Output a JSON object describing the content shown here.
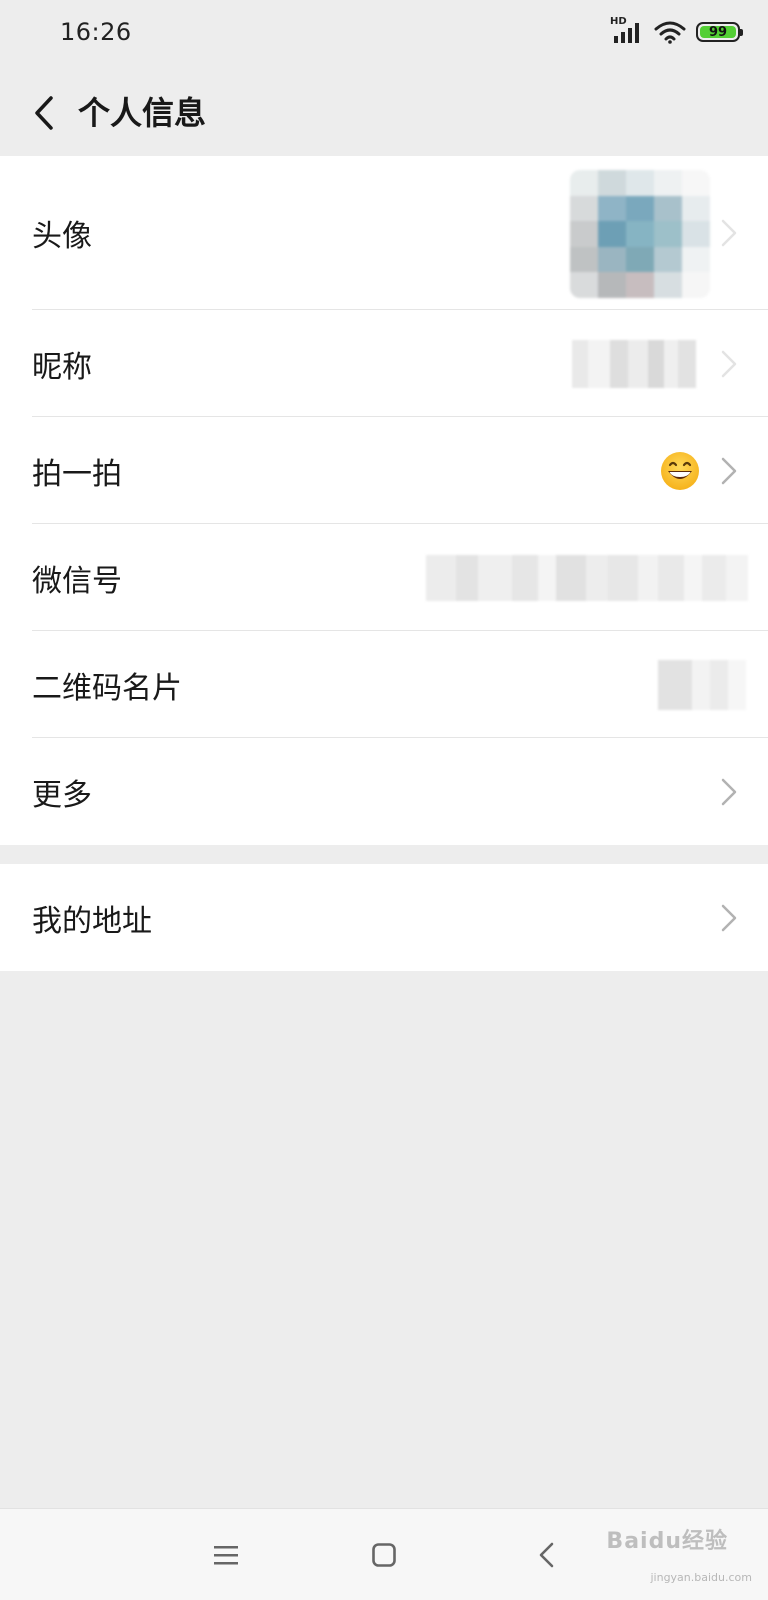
{
  "status_bar": {
    "time": "16:26",
    "network_label": "HD",
    "battery_level": "99",
    "battery_color": "#53cf34"
  },
  "header": {
    "back_icon": "chevron-left-icon",
    "title": "个人信息"
  },
  "profile_items": [
    {
      "label": "头像",
      "value_type": "avatar-image-blurred"
    },
    {
      "label": "昵称",
      "value_type": "blurred-text"
    },
    {
      "label": "拍一拍",
      "value_type": "emoji",
      "emoji_name": "grinning-face-icon"
    },
    {
      "label": "微信号",
      "value_type": "blurred-text"
    },
    {
      "label": "二维码名片",
      "value_type": "blurred-qr"
    },
    {
      "label": "更多",
      "value_type": "none"
    }
  ],
  "address_items": [
    {
      "label": "我的地址",
      "value_type": "none"
    }
  ],
  "nav_bar": {
    "buttons": [
      "menu-icon",
      "home-square-icon",
      "back-triangle-icon"
    ]
  },
  "watermark": {
    "text": "Baidu经验",
    "url": "jingyan.baidu.com"
  },
  "colors": {
    "page_background": "#ededed",
    "card_background": "#ffffff",
    "divider": "#e5e5e5",
    "chevron": "#b2b2b2"
  }
}
